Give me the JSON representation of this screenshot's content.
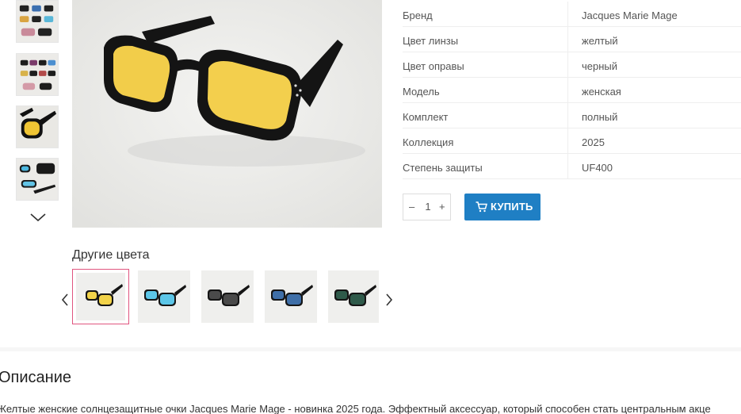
{
  "gallery": {
    "thumbnails": [
      "thumb-1",
      "thumb-2",
      "thumb-3",
      "thumb-4"
    ],
    "down_icon": "chevron-down-icon"
  },
  "specs": [
    {
      "key": "Бренд",
      "value": "Jacques Marie Mage"
    },
    {
      "key": "Цвет линзы",
      "value": "желтый"
    },
    {
      "key": "Цвет оправы",
      "value": "черный"
    },
    {
      "key": "Модель",
      "value": "женская"
    },
    {
      "key": "Комплект",
      "value": "полный"
    },
    {
      "key": "Коллекция",
      "value": "2025"
    },
    {
      "key": "Степень защиты",
      "value": "UF400"
    }
  ],
  "quantity": {
    "minus": "–",
    "value": "1",
    "plus": "+"
  },
  "buy_button": {
    "label": "КУПИТЬ",
    "icon": "cart-icon",
    "color": "#1f7fc4"
  },
  "other_colors": {
    "title": "Другие цвета",
    "lens_colors": [
      "#f2d34a",
      "#5cc6e8",
      "#4a4a4a",
      "#3f6fa8",
      "#2f5a4a"
    ],
    "active_border": "#e0557f"
  },
  "description": {
    "title": "Описание",
    "text": "Желтые женские солнцезащитные очки Jacques Marie Mage - новинка 2025 года. Эффектный аксессуар, который способен стать центральным акце"
  }
}
